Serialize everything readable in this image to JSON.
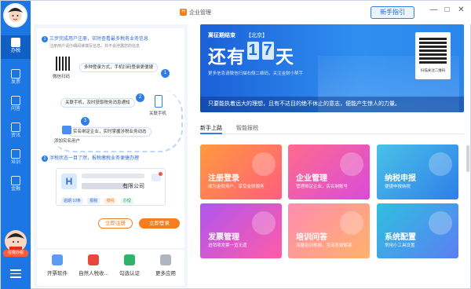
{
  "title_bar": {
    "app_badge": "H",
    "app_name": "企业管理",
    "guide_button": "新手指引",
    "minimize": "—",
    "maximize": "□",
    "close": "✕"
  },
  "rail": {
    "items": [
      {
        "label": "办税",
        "icon": "tax-icon",
        "active": true
      },
      {
        "label": "发票",
        "icon": "invoice-icon"
      },
      {
        "label": "问答",
        "icon": "qa-icon"
      },
      {
        "label": "资讯",
        "icon": "news-icon"
      },
      {
        "label": "培训",
        "icon": "training-icon"
      },
      {
        "label": "金融",
        "icon": "finance-icon"
      }
    ],
    "mascot_tag": "任我办税",
    "menu_icon": "menu-icon"
  },
  "intro": {
    "step1_title": "三步完成用户注册，实时查看最多税务业务信息",
    "step1_sub": "注册用户请仔细阅读填写信息，并不会泄露您的信息",
    "scan_label": "微信扫码",
    "bubble1": "多种登录方式，手机扫码登录更便捷",
    "bubble2": "关联手机，及时获取税务消息通知",
    "phone_label": "关联手机",
    "bubble3": "实名绑定企业，实时掌握涉税业务动态",
    "add_user_label": "添加实名用户",
    "step2_title": "涉税状态一目了然，报税缴税业务便捷办理",
    "company_name": "有限公司",
    "chips": [
      "逾期 10条",
      "报税",
      "缴税",
      "办理"
    ],
    "register_button": "立即注册",
    "login_button": "立即登录"
  },
  "tools": [
    {
      "label": "开票软件",
      "icon": "invoice-software-icon",
      "color": "#5b9cf2"
    },
    {
      "label": "自然人税收...",
      "icon": "personal-tax-icon",
      "color": "#e8473c"
    },
    {
      "label": "勾选认证",
      "icon": "check-auth-icon",
      "color": "#2fb36a"
    },
    {
      "label": "更多应用",
      "icon": "more-apps-icon",
      "color": "#b0b6c0"
    }
  ],
  "hero": {
    "deadline_title": "离征期结束",
    "location": "【北京】",
    "days_prefix": "还有",
    "digit1": "1",
    "digit2": "7",
    "days_suffix": "天",
    "small_text": "更多信息请微信扫描右侧二维码，关注金财小帮手",
    "qr_label": "扫描关注二维码",
    "quote": "只要能执着远大的理想，且有不达目的绝不休止的意志，便能产生惊人的力量。"
  },
  "tabs": [
    {
      "label": "新手上路",
      "active": true
    },
    {
      "label": "智能报税",
      "active": false
    }
  ],
  "tiles": [
    {
      "title": "注册登录",
      "sub": "成为金财用户，享受金财服务",
      "colors": [
        "#ff9a3c",
        "#ff5e7e"
      ]
    },
    {
      "title": "企业管理",
      "sub": "管理绑定企业，实名制账号",
      "colors": [
        "#ff6b8e",
        "#d94bd8"
      ]
    },
    {
      "title": "纳税申报",
      "sub": "便捷申报纳税",
      "colors": [
        "#49c2e8",
        "#2f7ee8"
      ]
    },
    {
      "title": "发票管理",
      "sub": "进销项发票一览无遗",
      "colors": [
        "#b055f0",
        "#ff5ca8"
      ]
    },
    {
      "title": "培训问答",
      "sub": "海量培训视频，互动答疑解惑",
      "colors": [
        "#ff8bb0",
        "#ffb26b"
      ]
    },
    {
      "title": "系统配置",
      "sub": "常用小工具设置",
      "colors": [
        "#2fc0e0",
        "#5b7ef2"
      ]
    }
  ]
}
